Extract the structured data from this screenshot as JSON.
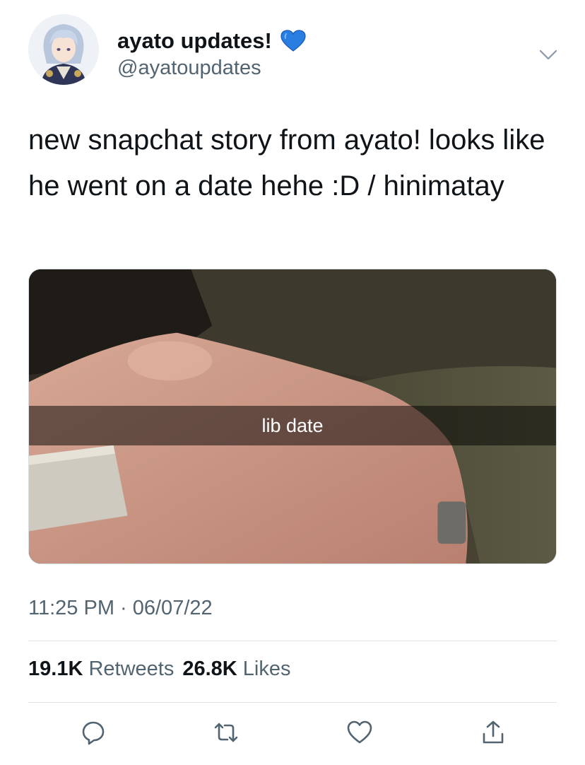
{
  "tweet": {
    "display_name": "ayato updates!",
    "handle": "@ayatoupdates",
    "text": "new snapchat story from ayato! looks like he went on a date hehe :D / hinimatay",
    "media_caption": "lib date",
    "timestamp": "11:25 PM · 06/07/22"
  },
  "stats": {
    "retweets_count": "19.1K",
    "retweets_label": "Retweets",
    "likes_count": "26.8K",
    "likes_label": "Likes"
  },
  "icons": {
    "verified_heart": "blue-heart-icon",
    "more": "chevron-down-icon",
    "reply": "reply-icon",
    "retweet": "retweet-icon",
    "like": "like-icon",
    "share": "share-icon"
  },
  "colors": {
    "heart_blue": "#2a7de1",
    "icon_gray": "#536471"
  }
}
